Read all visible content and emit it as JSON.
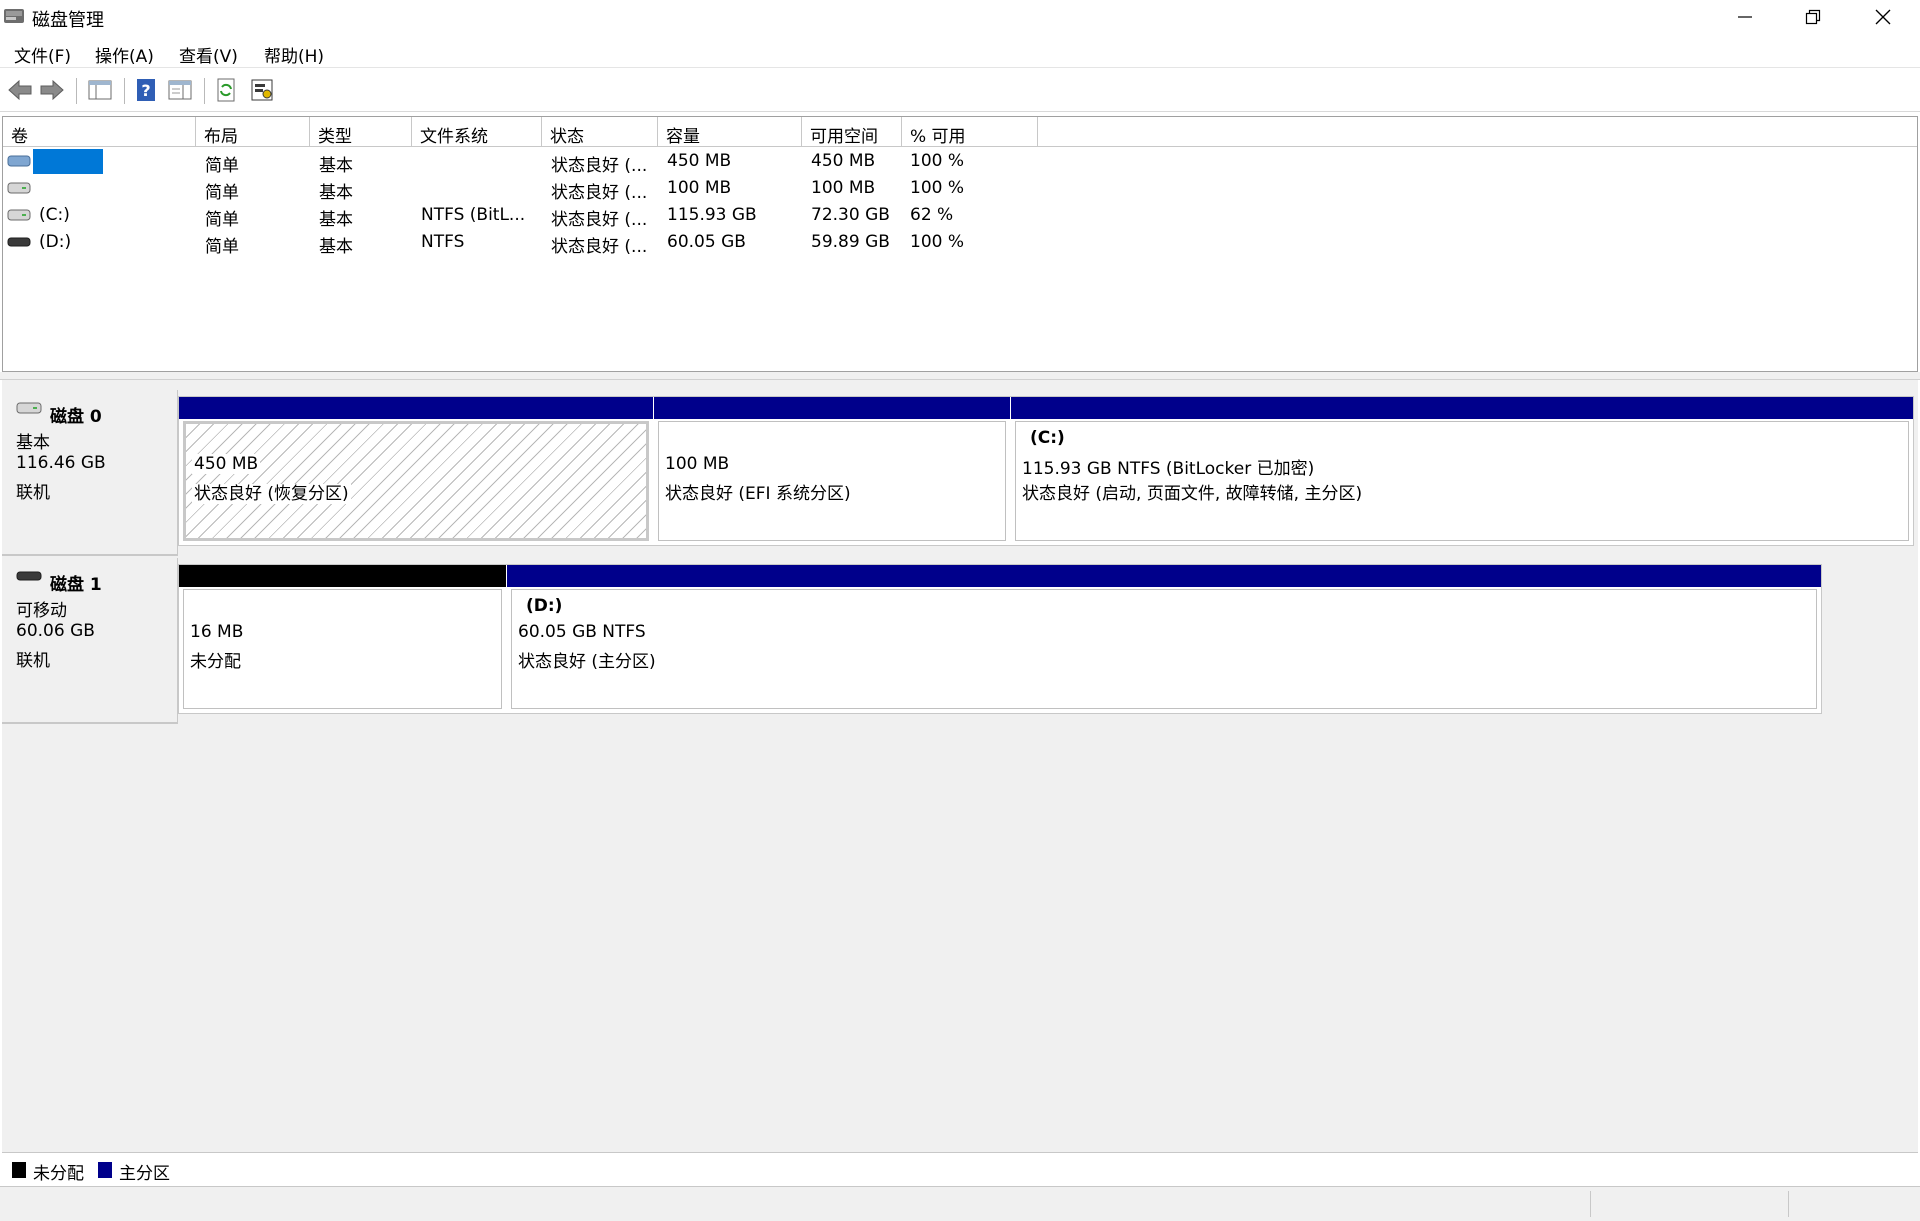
{
  "window": {
    "title": "磁盘管理"
  },
  "menu": [
    "文件(F)",
    "操作(A)",
    "查看(V)",
    "帮助(H)"
  ],
  "toolbar": [
    "back-arrow-icon",
    "forward-arrow-icon",
    "console-tree-icon",
    "help-icon",
    "details-pane-icon",
    "refresh-icon",
    "properties-icon"
  ],
  "columns": [
    "卷",
    "布局",
    "类型",
    "文件系统",
    "状态",
    "容量",
    "可用空间",
    "% 可用"
  ],
  "volumes": [
    {
      "name": "",
      "layout": "简单",
      "type": "基本",
      "fs": "",
      "status": "状态良好 (...",
      "capacity": "450 MB",
      "free": "450 MB",
      "pct": "100 %"
    },
    {
      "name": "",
      "layout": "简单",
      "type": "基本",
      "fs": "",
      "status": "状态良好 (...",
      "capacity": "100 MB",
      "free": "100 MB",
      "pct": "100 %"
    },
    {
      "name": "(C:)",
      "layout": "简单",
      "type": "基本",
      "fs": "NTFS (BitL...",
      "status": "状态良好 (...",
      "capacity": "115.93 GB",
      "free": "72.30 GB",
      "pct": "62 %"
    },
    {
      "name": "(D:)",
      "layout": "简单",
      "type": "基本",
      "fs": "NTFS",
      "status": "状态良好 (...",
      "capacity": "60.05 GB",
      "free": "59.89 GB",
      "pct": "100 %"
    }
  ],
  "disks": [
    {
      "name": "磁盘 0",
      "kind": "基本",
      "size": "116.46 GB",
      "state": "联机",
      "partitions": [
        {
          "letter": "",
          "size": "450 MB",
          "status": "状态良好 (恢复分区)",
          "color": "#00008b"
        },
        {
          "letter": "",
          "size": "100 MB",
          "status": "状态良好 (EFI 系统分区)",
          "color": "#00008b"
        },
        {
          "letter": "(C:)",
          "size": "115.93 GB NTFS (BitLocker 已加密)",
          "status": "状态良好 (启动, 页面文件, 故障转储, 主分区)",
          "color": "#00008b"
        }
      ]
    },
    {
      "name": "磁盘 1",
      "kind": "可移动",
      "size": "60.06 GB",
      "state": "联机",
      "partitions": [
        {
          "letter": "",
          "size": "16 MB",
          "status": "未分配",
          "color": "#000000"
        },
        {
          "letter": "(D:)",
          "size": "60.05 GB NTFS",
          "status": "状态良好 (主分区)",
          "color": "#00008b"
        }
      ]
    }
  ],
  "legend": [
    {
      "label": "未分配",
      "color": "#000000"
    },
    {
      "label": "主分区",
      "color": "#00008b"
    }
  ]
}
